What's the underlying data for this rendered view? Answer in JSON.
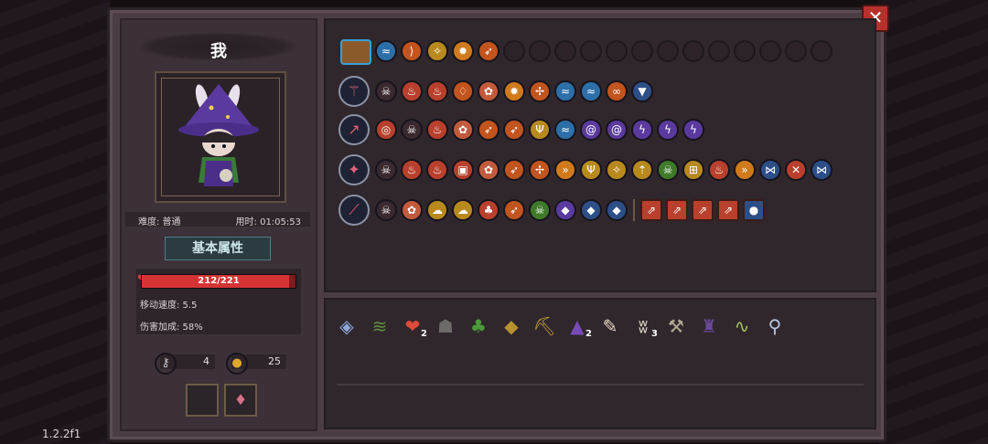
{
  "version": "1.2.2f1",
  "player": {
    "name": "我",
    "difficulty": "难度: 普通",
    "time": "用时: 01:05:53"
  },
  "attributes": {
    "title": "基本属性",
    "hp_text": "212/221",
    "hp_fraction": 0.959,
    "move_speed": "移动速度: 5.5",
    "damage_bonus": "伤害加成: 58%"
  },
  "currency": {
    "keys": "4",
    "coins": "25"
  },
  "close_label": "✕",
  "colors": {
    "hp": "#d63434",
    "panel": "#4a3d44",
    "accent": "#3a9ed9"
  },
  "rows": [
    {
      "name": "inventory",
      "lead": "chest-icon",
      "items": [
        {
          "icon": "wave-icon",
          "color": "#2d6fa8"
        },
        {
          "icon": "bow-icon",
          "color": "#c2541e"
        },
        {
          "icon": "feather-icon",
          "color": "#b88a1e"
        },
        {
          "icon": "sun-icon",
          "color": "#d07a1c"
        },
        {
          "icon": "arrow-icon",
          "color": "#c2541e"
        }
      ],
      "empty": 13
    },
    {
      "name": "weapon-1",
      "lead": "staff-icon",
      "items": [
        {
          "icon": "skull-icon",
          "color": "#3a2a30",
          "lock": true
        },
        {
          "icon": "fire-icon",
          "color": "#b8402c"
        },
        {
          "icon": "fire-icon",
          "color": "#b8402c"
        },
        {
          "icon": "flame-icon",
          "color": "#c2541e"
        },
        {
          "icon": "flower-icon",
          "color": "#c25a3c"
        },
        {
          "icon": "sun-icon",
          "color": "#d07a1c"
        },
        {
          "icon": "triad-icon",
          "color": "#c2541e"
        },
        {
          "icon": "wave-icon",
          "color": "#2d6fa8"
        },
        {
          "icon": "wave-icon",
          "color": "#2d6fa8"
        },
        {
          "icon": "swirl-icon",
          "color": "#c2541e"
        },
        {
          "icon": "shield-icon",
          "color": "#2d4f88"
        }
      ],
      "empty": 0
    },
    {
      "name": "weapon-2",
      "lead": "spear-icon",
      "items": [
        {
          "icon": "target-icon",
          "color": "#b8402c",
          "lock": true
        },
        {
          "icon": "skull-icon",
          "color": "#3a2a30",
          "lock": true
        },
        {
          "icon": "fire-icon",
          "color": "#b8402c"
        },
        {
          "icon": "flower-icon",
          "color": "#c25a3c"
        },
        {
          "icon": "arrow-icon",
          "color": "#c2541e"
        },
        {
          "icon": "arrow-icon",
          "color": "#c2541e"
        },
        {
          "icon": "fork-icon",
          "color": "#b88a1e"
        },
        {
          "icon": "wave-icon",
          "color": "#2d6fa8"
        },
        {
          "icon": "vortex-icon",
          "color": "#5a3a9e"
        },
        {
          "icon": "vortex-icon",
          "color": "#5a3a9e"
        },
        {
          "icon": "bolt-icon",
          "color": "#5a3a9e"
        },
        {
          "icon": "bolt-icon",
          "color": "#5a3a9e"
        },
        {
          "icon": "bolt-icon",
          "color": "#5a3a9e"
        }
      ],
      "empty": 0
    },
    {
      "name": "weapon-3",
      "lead": "shuriken-icon",
      "items": [
        {
          "icon": "skull-icon",
          "color": "#3a2a30",
          "lock": true
        },
        {
          "icon": "fire-icon",
          "color": "#b8402c"
        },
        {
          "icon": "fire-icon",
          "color": "#b8402c"
        },
        {
          "icon": "box-icon",
          "color": "#b8402c"
        },
        {
          "icon": "flower-icon",
          "color": "#c25a3c"
        },
        {
          "icon": "arrow-icon",
          "color": "#c2541e"
        },
        {
          "icon": "triad-icon",
          "color": "#c2541e"
        },
        {
          "icon": "chevron-icon",
          "color": "#d07a1c"
        },
        {
          "icon": "fork-icon",
          "color": "#b88a1e"
        },
        {
          "icon": "feather-icon",
          "color": "#b88a1e"
        },
        {
          "icon": "up-icon",
          "color": "#b88a1e"
        },
        {
          "icon": "skull-green-icon",
          "color": "#3f7a2a"
        },
        {
          "icon": "grid-icon",
          "color": "#b88a1e"
        },
        {
          "icon": "fire-icon",
          "color": "#b8402c"
        },
        {
          "icon": "chevron-icon",
          "color": "#d07a1c"
        },
        {
          "icon": "butterfly-icon",
          "color": "#2d4f88"
        },
        {
          "icon": "cross-icon",
          "color": "#b8402c"
        },
        {
          "icon": "butterfly-icon",
          "color": "#2d4f88"
        }
      ],
      "empty": 0
    },
    {
      "name": "weapon-4",
      "lead": "wand-icon",
      "items": [
        {
          "icon": "skull-icon",
          "color": "#3a2a30",
          "lock": true
        },
        {
          "icon": "flower-icon",
          "color": "#c25a3c"
        },
        {
          "icon": "cloud-icon",
          "color": "#b88a1e"
        },
        {
          "icon": "cloud-icon",
          "color": "#b88a1e"
        },
        {
          "icon": "cherry-icon",
          "color": "#b8402c"
        },
        {
          "icon": "arrow-icon",
          "color": "#c2541e"
        },
        {
          "icon": "skull-green-icon",
          "color": "#3f7a2a"
        },
        {
          "icon": "crystal-icon",
          "color": "#5a3a9e"
        },
        {
          "icon": "crystal-icon",
          "color": "#2d4f88"
        },
        {
          "icon": "crystal-icon",
          "color": "#2d4f88"
        }
      ],
      "extras": [
        {
          "icon": "arrows-icon",
          "color": "#b8402c"
        },
        {
          "icon": "arrows-icon",
          "color": "#b8402c"
        },
        {
          "icon": "arrows-icon",
          "color": "#b8402c"
        },
        {
          "icon": "arrows-icon",
          "color": "#b8402c"
        },
        {
          "icon": "rock-icon",
          "color": "#2d4f88"
        }
      ],
      "empty": 0
    }
  ],
  "passives": [
    {
      "icon": "mirror-icon",
      "glyph": "◈",
      "color": "#8fa8d8",
      "count": ""
    },
    {
      "icon": "boomerang-icon",
      "glyph": "≋",
      "color": "#5e8e3a",
      "count": ""
    },
    {
      "icon": "heart-icon",
      "glyph": "❤",
      "color": "#e04a3a",
      "count": "2"
    },
    {
      "icon": "tombstone-icon",
      "glyph": "☗",
      "color": "#6e6a6a",
      "count": ""
    },
    {
      "icon": "plant-icon",
      "glyph": "♣",
      "color": "#4a9a3a",
      "count": ""
    },
    {
      "icon": "map-icon",
      "glyph": "◆",
      "color": "#b8922e",
      "count": ""
    },
    {
      "icon": "pickaxe-icon",
      "glyph": "⛏",
      "color": "#c29a3e",
      "count": ""
    },
    {
      "icon": "wizard-hat-icon",
      "glyph": "▲",
      "color": "#7a4ab8",
      "count": "2"
    },
    {
      "icon": "feather-quill-icon",
      "glyph": "✎",
      "color": "#e8d8c8",
      "count": ""
    },
    {
      "icon": "fangs-icon",
      "glyph": "ʬ",
      "color": "#e8e0d0",
      "count": "3"
    },
    {
      "icon": "drill-icon",
      "glyph": "⚒",
      "color": "#b0a890",
      "count": ""
    },
    {
      "icon": "cloak-icon",
      "glyph": "♜",
      "color": "#6a4a9a",
      "count": ""
    },
    {
      "icon": "worm-icon",
      "glyph": "∿",
      "color": "#a8c05a",
      "count": ""
    },
    {
      "icon": "magnifier-icon",
      "glyph": "⚲",
      "color": "#b8c8e8",
      "count": ""
    }
  ]
}
